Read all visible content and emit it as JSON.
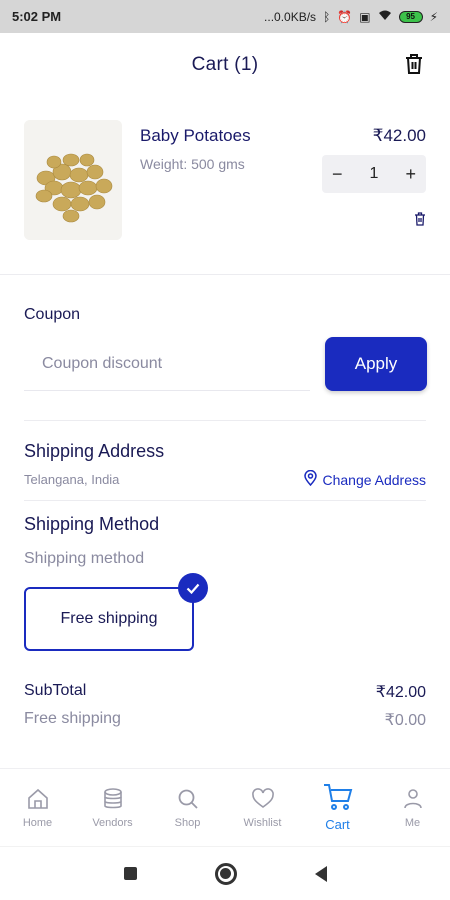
{
  "status_bar": {
    "time": "5:02 PM",
    "network_speed": "...0.0KB/s",
    "battery": "95"
  },
  "header": {
    "title": "Cart (1)"
  },
  "cart_item": {
    "name": "Baby Potatoes",
    "weight": "Weight: 500 gms",
    "price": "₹42.00",
    "quantity": "1",
    "minus": "−",
    "plus": "+"
  },
  "coupon": {
    "label": "Coupon",
    "placeholder": "Coupon discount",
    "apply_label": "Apply"
  },
  "shipping": {
    "address_title": "Shipping Address",
    "address": "Telangana, India",
    "change_label": "Change Address",
    "method_title": "Shipping Method",
    "method_subtitle": "Shipping method",
    "selected_option": "Free shipping"
  },
  "summary": {
    "subtotal_label": "SubTotal",
    "subtotal_value": "₹42.00",
    "shipping_label": "Free shipping",
    "shipping_value": "₹0.00"
  },
  "bottom_nav": {
    "items": [
      {
        "label": "Home",
        "icon": "home-icon"
      },
      {
        "label": "Vendors",
        "icon": "database-icon"
      },
      {
        "label": "Shop",
        "icon": "search-icon"
      },
      {
        "label": "Wishlist",
        "icon": "heart-icon"
      },
      {
        "label": "Cart",
        "icon": "cart-icon",
        "active": true
      },
      {
        "label": "Me",
        "icon": "person-icon"
      }
    ]
  },
  "colors": {
    "primary": "#1a2bbf",
    "active_nav": "#1f7fe8",
    "text_dark": "#1a1a55",
    "text_muted": "#8a8aa0"
  }
}
